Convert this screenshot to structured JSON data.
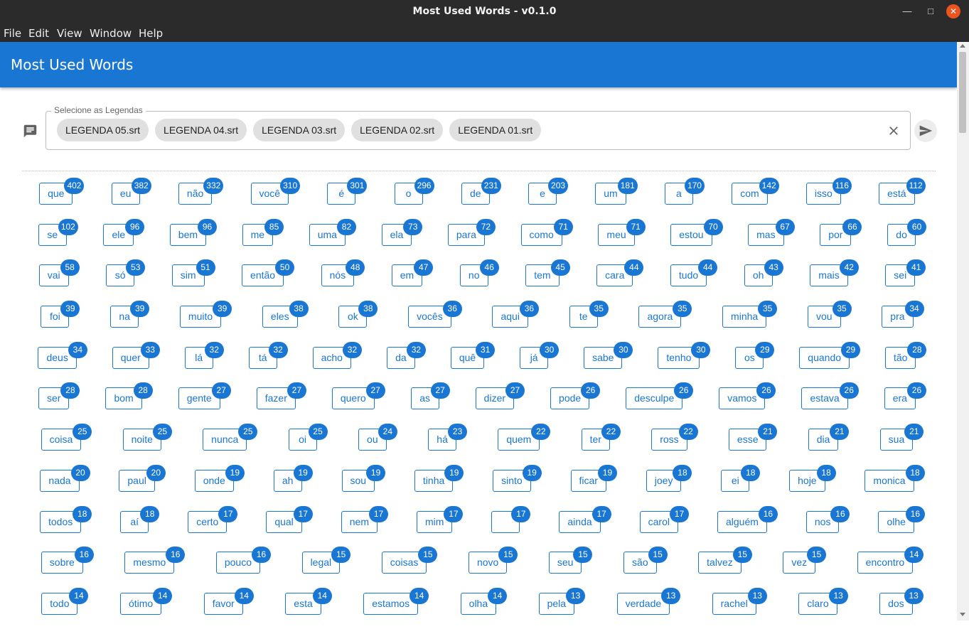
{
  "window": {
    "title": "Most Used Words - v0.1.0"
  },
  "menu": [
    "File",
    "Edit",
    "View",
    "Window",
    "Help"
  ],
  "appbar": {
    "title": "Most Used Words"
  },
  "legend": {
    "label": "Selecione as Legendas",
    "chips": [
      "LEGENDA 05.srt",
      "LEGENDA 04.srt",
      "LEGENDA 03.srt",
      "LEGENDA 02.srt",
      "LEGENDA 01.srt"
    ]
  },
  "colors": {
    "primary": "#1976d2",
    "titlebar": "#2b2b2b",
    "close": "#e95420"
  },
  "words": [
    [
      [
        "que",
        "402"
      ],
      [
        "eu",
        "382"
      ],
      [
        "não",
        "332"
      ],
      [
        "você",
        "310"
      ],
      [
        "é",
        "301"
      ],
      [
        "o",
        "296"
      ],
      [
        "de",
        "231"
      ],
      [
        "e",
        "203"
      ],
      [
        "um",
        "181"
      ],
      [
        "a",
        "170"
      ],
      [
        "com",
        "142"
      ],
      [
        "isso",
        "116"
      ],
      [
        "está",
        "112"
      ]
    ],
    [
      [
        "se",
        "102"
      ],
      [
        "ele",
        "96"
      ],
      [
        "bem",
        "96"
      ],
      [
        "me",
        "85"
      ],
      [
        "uma",
        "82"
      ],
      [
        "ela",
        "73"
      ],
      [
        "para",
        "72"
      ],
      [
        "como",
        "71"
      ],
      [
        "meu",
        "71"
      ],
      [
        "estou",
        "70"
      ],
      [
        "mas",
        "67"
      ],
      [
        "por",
        "66"
      ],
      [
        "do",
        "60"
      ]
    ],
    [
      [
        "vai",
        "58"
      ],
      [
        "só",
        "53"
      ],
      [
        "sim",
        "51"
      ],
      [
        "então",
        "50"
      ],
      [
        "nós",
        "48"
      ],
      [
        "em",
        "47"
      ],
      [
        "no",
        "46"
      ],
      [
        "tem",
        "45"
      ],
      [
        "cara",
        "44"
      ],
      [
        "tudo",
        "44"
      ],
      [
        "oh",
        "43"
      ],
      [
        "mais",
        "42"
      ],
      [
        "sei",
        "41"
      ]
    ],
    [
      [
        "foi",
        "39"
      ],
      [
        "na",
        "39"
      ],
      [
        "muito",
        "39"
      ],
      [
        "eles",
        "38"
      ],
      [
        "ok",
        "38"
      ],
      [
        "vocês",
        "36"
      ],
      [
        "aqui",
        "36"
      ],
      [
        "te",
        "35"
      ],
      [
        "agora",
        "35"
      ],
      [
        "minha",
        "35"
      ],
      [
        "vou",
        "35"
      ],
      [
        "pra",
        "34"
      ]
    ],
    [
      [
        "deus",
        "34"
      ],
      [
        "quer",
        "33"
      ],
      [
        "lá",
        "32"
      ],
      [
        "tá",
        "32"
      ],
      [
        "acho",
        "32"
      ],
      [
        "da",
        "32"
      ],
      [
        "quê",
        "31"
      ],
      [
        "já",
        "30"
      ],
      [
        "sabe",
        "30"
      ],
      [
        "tenho",
        "30"
      ],
      [
        "os",
        "29"
      ],
      [
        "quando",
        "29"
      ],
      [
        "tão",
        "28"
      ]
    ],
    [
      [
        "ser",
        "28"
      ],
      [
        "bom",
        "28"
      ],
      [
        "gente",
        "27"
      ],
      [
        "fazer",
        "27"
      ],
      [
        "quero",
        "27"
      ],
      [
        "as",
        "27"
      ],
      [
        "dizer",
        "27"
      ],
      [
        "pode",
        "26"
      ],
      [
        "desculpe",
        "26"
      ],
      [
        "vamos",
        "26"
      ],
      [
        "estava",
        "26"
      ],
      [
        "era",
        "26"
      ]
    ],
    [
      [
        "coisa",
        "25"
      ],
      [
        "noite",
        "25"
      ],
      [
        "nunca",
        "25"
      ],
      [
        "oi",
        "25"
      ],
      [
        "ou",
        "24"
      ],
      [
        "há",
        "23"
      ],
      [
        "quem",
        "22"
      ],
      [
        "ter",
        "22"
      ],
      [
        "ross",
        "22"
      ],
      [
        "esse",
        "21"
      ],
      [
        "dia",
        "21"
      ],
      [
        "sua",
        "21"
      ]
    ],
    [
      [
        "nada",
        "20"
      ],
      [
        "paul",
        "20"
      ],
      [
        "onde",
        "19"
      ],
      [
        "ah",
        "19"
      ],
      [
        "sou",
        "19"
      ],
      [
        "tinha",
        "19"
      ],
      [
        "sinto",
        "19"
      ],
      [
        "ficar",
        "19"
      ],
      [
        "joey",
        "18"
      ],
      [
        "ei",
        "18"
      ],
      [
        "hoje",
        "18"
      ],
      [
        "monica",
        "18"
      ]
    ],
    [
      [
        "todos",
        "18"
      ],
      [
        "aí",
        "18"
      ],
      [
        "certo",
        "17"
      ],
      [
        "qual",
        "17"
      ],
      [
        "nem",
        "17"
      ],
      [
        "mim",
        "17"
      ],
      [
        "",
        "17"
      ],
      [
        "ainda",
        "17"
      ],
      [
        "carol",
        "17"
      ],
      [
        "alguém",
        "16"
      ],
      [
        "nos",
        "16"
      ],
      [
        "olhe",
        "16"
      ]
    ],
    [
      [
        "sobre",
        "16"
      ],
      [
        "mesmo",
        "16"
      ],
      [
        "pouco",
        "16"
      ],
      [
        "legal",
        "15"
      ],
      [
        "coisas",
        "15"
      ],
      [
        "novo",
        "15"
      ],
      [
        "seu",
        "15"
      ],
      [
        "são",
        "15"
      ],
      [
        "talvez",
        "15"
      ],
      [
        "vez",
        "15"
      ],
      [
        "encontro",
        "14"
      ]
    ],
    [
      [
        "todo",
        "14"
      ],
      [
        "ótimo",
        "14"
      ],
      [
        "favor",
        "14"
      ],
      [
        "esta",
        "14"
      ],
      [
        "estamos",
        "14"
      ],
      [
        "olha",
        "14"
      ],
      [
        "pela",
        "13"
      ],
      [
        "verdade",
        "13"
      ],
      [
        "rachel",
        "13"
      ],
      [
        "claro",
        "13"
      ],
      [
        "dos",
        "13"
      ]
    ]
  ]
}
